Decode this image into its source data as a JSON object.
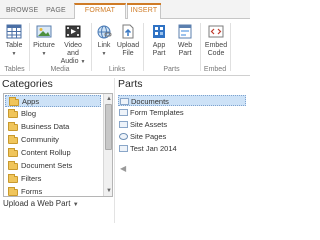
{
  "tabs": [
    {
      "label": "BROWSE"
    },
    {
      "label": "PAGE"
    },
    {
      "label": "FORMAT TEXT"
    },
    {
      "label": "INSERT"
    }
  ],
  "ribbon": {
    "table": {
      "label": "Table"
    },
    "picture": {
      "label": "Picture"
    },
    "video": {
      "label1": "Video and",
      "label2": "Audio"
    },
    "link": {
      "label": "Link"
    },
    "upload": {
      "label1": "Upload",
      "label2": "File"
    },
    "app_part": {
      "label1": "App",
      "label2": "Part"
    },
    "web_part": {
      "label1": "Web",
      "label2": "Part"
    },
    "embed": {
      "label1": "Embed",
      "label2": "Code"
    },
    "groups": {
      "tables": "Tables",
      "media": "Media",
      "links": "Links",
      "parts": "Parts",
      "embed": "Embed"
    }
  },
  "categories": {
    "title": "Categories",
    "items": [
      "Apps",
      "Blog",
      "Business Data",
      "Community",
      "Content Rollup",
      "Document Sets",
      "Filters",
      "Forms"
    ],
    "selected_index": 0,
    "upload_label": "Upload a Web Part"
  },
  "parts": {
    "title": "Parts",
    "items": [
      {
        "label": "Documents",
        "icon": "document-library-icon"
      },
      {
        "label": "Form Templates",
        "icon": "form-library-icon"
      },
      {
        "label": "Site Assets",
        "icon": "document-library-icon"
      },
      {
        "label": "Site Pages",
        "icon": "site-pages-icon"
      },
      {
        "label": "Test Jan 2014",
        "icon": "list-icon"
      }
    ],
    "selected_index": 0
  },
  "colors": {
    "accent": "#cf7b26",
    "selection": "#cde2f7"
  }
}
